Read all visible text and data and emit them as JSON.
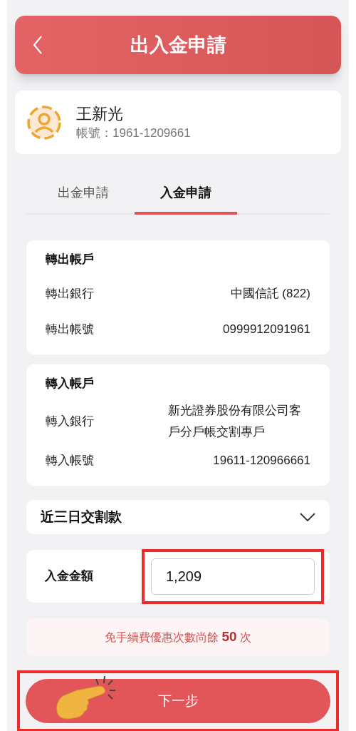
{
  "header": {
    "title": "出入金申請"
  },
  "user": {
    "name": "王新光",
    "account_label": "帳號：",
    "account": "1961-1209661"
  },
  "tabs": [
    {
      "label": "出金申請",
      "selected": false
    },
    {
      "label": "入金申請",
      "selected": true
    }
  ],
  "sections": [
    {
      "title": "轉出帳戶",
      "rows": [
        {
          "label": "轉出銀行",
          "value": "中國信託 (822)"
        },
        {
          "label": "轉出帳號",
          "value": "0999912091961"
        }
      ]
    },
    {
      "title": "轉入帳戶",
      "rows": [
        {
          "label": "轉入銀行",
          "value": "新光證券股份有限公司客戶分戶帳交割專戶"
        },
        {
          "label": "轉入帳號",
          "value": "19611-120966661"
        }
      ]
    }
  ],
  "dropdown": {
    "label": "近三日交割款",
    "expanded": false
  },
  "amount": {
    "label": "入金金額",
    "value": "1,209",
    "highlighted": true
  },
  "notice": "免手續費優惠次數尚餘 **50** 次",
  "next_button": {
    "label": "下一步",
    "highlighted": true
  }
}
